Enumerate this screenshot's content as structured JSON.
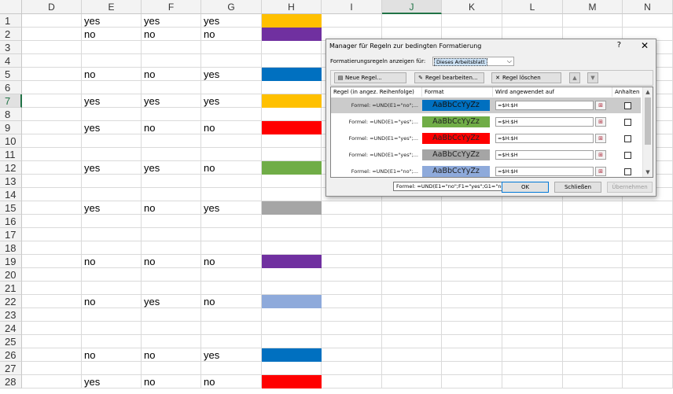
{
  "sheet": {
    "columns": [
      "D",
      "E",
      "F",
      "G",
      "H",
      "I",
      "J",
      "K",
      "L",
      "M",
      "N"
    ],
    "selected_column": "J",
    "selected_row": 7,
    "rows": [
      {
        "n": 1,
        "e": "yes",
        "f": "yes",
        "g": "yes",
        "h": "#ffc000"
      },
      {
        "n": 2,
        "e": "no",
        "f": "no",
        "g": "no",
        "h": "#7030a0"
      },
      {
        "n": 3,
        "e": "",
        "f": "",
        "g": "",
        "h": ""
      },
      {
        "n": 4,
        "e": "",
        "f": "",
        "g": "",
        "h": ""
      },
      {
        "n": 5,
        "e": "no",
        "f": "no",
        "g": "yes",
        "h": "#0070c0"
      },
      {
        "n": 6,
        "e": "",
        "f": "",
        "g": "",
        "h": ""
      },
      {
        "n": 7,
        "e": "yes",
        "f": "yes",
        "g": "yes",
        "h": "#ffc000"
      },
      {
        "n": 8,
        "e": "",
        "f": "",
        "g": "",
        "h": ""
      },
      {
        "n": 9,
        "e": "yes",
        "f": "no",
        "g": "no",
        "h": "#ff0000"
      },
      {
        "n": 10,
        "e": "",
        "f": "",
        "g": "",
        "h": ""
      },
      {
        "n": 11,
        "e": "",
        "f": "",
        "g": "",
        "h": ""
      },
      {
        "n": 12,
        "e": "yes",
        "f": "yes",
        "g": "no",
        "h": "#70ad47"
      },
      {
        "n": 13,
        "e": "",
        "f": "",
        "g": "",
        "h": ""
      },
      {
        "n": 14,
        "e": "",
        "f": "",
        "g": "",
        "h": ""
      },
      {
        "n": 15,
        "e": "yes",
        "f": "no",
        "g": "yes",
        "h": "#a5a5a5"
      },
      {
        "n": 16,
        "e": "",
        "f": "",
        "g": "",
        "h": ""
      },
      {
        "n": 17,
        "e": "",
        "f": "",
        "g": "",
        "h": ""
      },
      {
        "n": 18,
        "e": "",
        "f": "",
        "g": "",
        "h": ""
      },
      {
        "n": 19,
        "e": "no",
        "f": "no",
        "g": "no",
        "h": "#7030a0"
      },
      {
        "n": 20,
        "e": "",
        "f": "",
        "g": "",
        "h": ""
      },
      {
        "n": 21,
        "e": "",
        "f": "",
        "g": "",
        "h": ""
      },
      {
        "n": 22,
        "e": "no",
        "f": "yes",
        "g": "no",
        "h": "#8eaadb"
      },
      {
        "n": 23,
        "e": "",
        "f": "",
        "g": "",
        "h": ""
      },
      {
        "n": 24,
        "e": "",
        "f": "",
        "g": "",
        "h": ""
      },
      {
        "n": 25,
        "e": "",
        "f": "",
        "g": "",
        "h": ""
      },
      {
        "n": 26,
        "e": "no",
        "f": "no",
        "g": "yes",
        "h": "#0070c0"
      },
      {
        "n": 27,
        "e": "",
        "f": "",
        "g": "",
        "h": ""
      },
      {
        "n": 28,
        "e": "yes",
        "f": "no",
        "g": "no",
        "h": "#ff0000"
      }
    ]
  },
  "dialog": {
    "title": "Manager für Regeln zur bedingten Formatierung",
    "help": "?",
    "close": "✕",
    "show_label": "Formatierungsregeln anzeigen für:",
    "show_value": "Dieses Arbeitsblatt",
    "toolbar": {
      "new_rule": "Neue Regel...",
      "edit_rule": "Regel bearbeiten...",
      "delete_rule": "Regel löschen",
      "move_up": "▲",
      "move_down": "▼"
    },
    "grid_headers": {
      "rule": "Regel (in angez. Reihenfolge)",
      "format": "Format",
      "applies_to": "Wird angewendet auf",
      "stop": "Anhalten"
    },
    "rules": [
      {
        "rule": "Formel: =UND(E1=\"no\";...",
        "preview": "AaBbCcYyZz",
        "color": "#0070c0",
        "applies": "=$H:$H"
      },
      {
        "rule": "Formel: =UND(E1=\"yes\";...",
        "preview": "AaBbCcYyZz",
        "color": "#70ad47",
        "applies": "=$H:$H"
      },
      {
        "rule": "Formel: =UND(E1=\"yes\";...",
        "preview": "AaBbCcYyZz",
        "color": "#ff0000",
        "applies": "=$H:$H"
      },
      {
        "rule": "Formel: =UND(E1=\"yes\";...",
        "preview": "AaBbCcYyZz",
        "color": "#a5a5a5",
        "applies": "=$H:$H"
      },
      {
        "rule": "Formel: =UND(E1=\"no\";...",
        "preview": "AaBbCcYyZz",
        "color": "#8eaadb",
        "applies": "=$H:$H"
      }
    ],
    "tooltip": "Formel: =UND(E1=\"no\";F1=\"yes\";G1=\"no\")",
    "ok": "OK",
    "close_btn": "Schließen",
    "apply": "Übernehmen"
  }
}
